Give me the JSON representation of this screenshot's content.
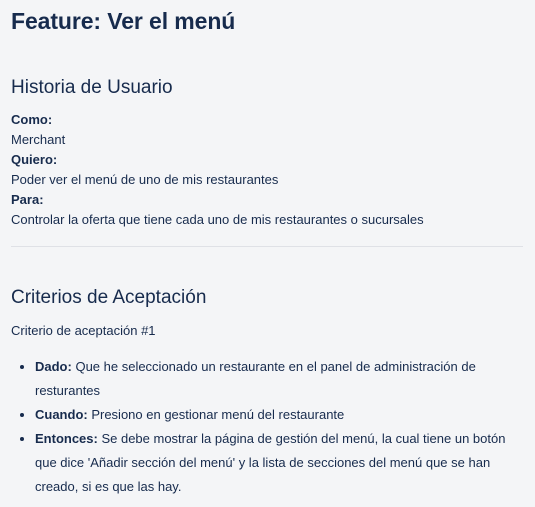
{
  "feature": {
    "title": "Feature: Ver el menú"
  },
  "user_story": {
    "heading": "Historia de Usuario",
    "as_label": "Como:",
    "as_value": "Merchant",
    "want_label": "Quiero:",
    "want_value": "Poder ver el menú de uno de mis restaurantes",
    "so_label": "Para:",
    "so_value": "Controlar la oferta que tiene cada uno de mis restaurantes o sucursales"
  },
  "acceptance": {
    "heading": "Criterios de Aceptación",
    "criterion_title": "Criterio de aceptación #1",
    "steps": [
      {
        "keyword": "Dado:",
        "text": " Que he seleccionado un restaurante en el panel de administración de resturantes"
      },
      {
        "keyword": "Cuando:",
        "text": " Presiono en gestionar menú del restaurante"
      },
      {
        "keyword": "Entonces:",
        "text": " Se debe mostrar la página de gestión del menú, la cual tiene un botón que dice 'Añadir sección del menú' y la lista de secciones del menú que se han creado, si es que las hay."
      }
    ]
  }
}
